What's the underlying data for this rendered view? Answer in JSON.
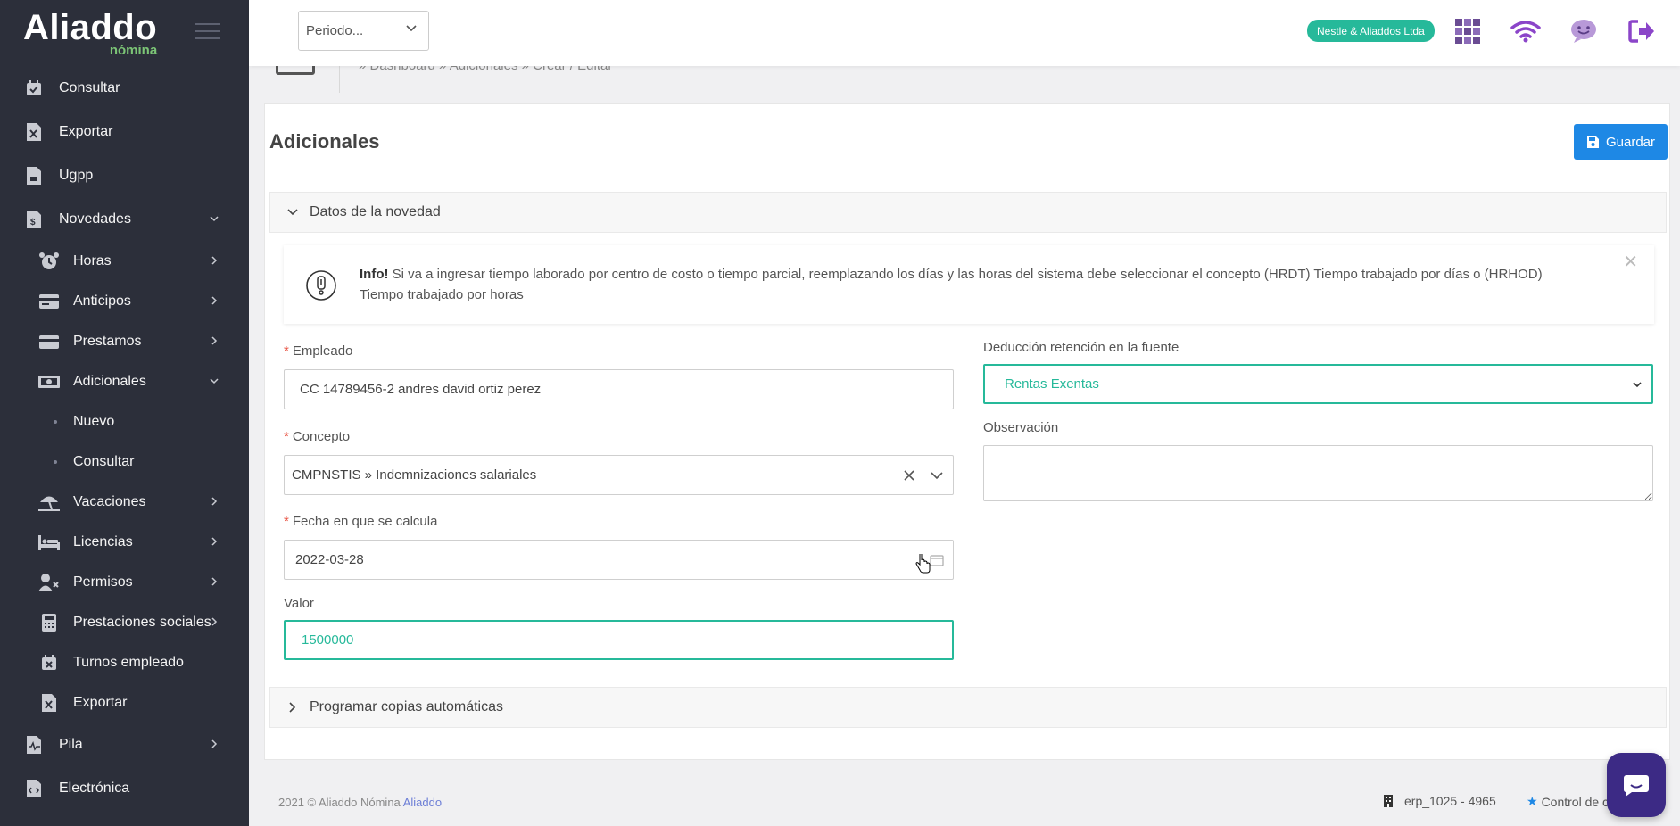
{
  "brand": {
    "logo_main": "Aliaddo",
    "logo_sub": "nómina"
  },
  "sidebar": {
    "items": [
      {
        "label": "Consultar"
      },
      {
        "label": "Exportar"
      },
      {
        "label": "Ugpp"
      },
      {
        "label": "Novedades"
      },
      {
        "label": "Horas"
      },
      {
        "label": "Anticipos"
      },
      {
        "label": "Prestamos"
      },
      {
        "label": "Adicionales"
      },
      {
        "label": "Nuevo"
      },
      {
        "label": "Consultar"
      },
      {
        "label": "Vacaciones"
      },
      {
        "label": "Licencias"
      },
      {
        "label": "Permisos"
      },
      {
        "label": "Prestaciones sociales"
      },
      {
        "label": "Turnos empleado"
      },
      {
        "label": "Exportar"
      },
      {
        "label": "Pila"
      },
      {
        "label": "Electrónica"
      }
    ]
  },
  "topbar": {
    "period_placeholder": "Periodo...",
    "company": "Nestle & Aliaddos Ltda"
  },
  "breadcrumb": {
    "text": "» Dashboard » Adicionales » Crear / Editar"
  },
  "page": {
    "title": "Adicionales",
    "save_label": "Guardar",
    "section_1": "Datos de la novedad",
    "section_2": "Programar copias automáticas"
  },
  "info": {
    "title": "Info!",
    "text": "Si va a ingresar tiempo laborado por centro de costo o tiempo parcial, reemplazando los días y las horas del sistema debe seleccionar el concepto (HRDT) Tiempo trabajado por días o (HRHOD) Tiempo trabajado por horas"
  },
  "form": {
    "required_mark": "*",
    "empleado_label": "Empleado",
    "empleado_value": "CC 14789456-2 andres david ortiz perez",
    "concepto_label": "Concepto",
    "concepto_value": "CMPNSTIS » Indemnizaciones salariales",
    "fecha_label": "Fecha en que se calcula",
    "fecha_value": "2022-03-28",
    "valor_label": "Valor",
    "valor_value": "1500000",
    "deduccion_label": "Deducción retención en la fuente",
    "deduccion_value": "Rentas Exentas",
    "observacion_label": "Observación",
    "observacion_value": ""
  },
  "footer": {
    "copyright": "2021 © Aliaddo Nómina",
    "copyright_link": "Aliaddo",
    "erp": "erp_1025 - 4965",
    "control": "Control de c"
  },
  "colors": {
    "accent": "#26b99a",
    "primary": "#1e88e5",
    "sidebar": "#2c2f3a",
    "purple": "#8b45c9"
  }
}
